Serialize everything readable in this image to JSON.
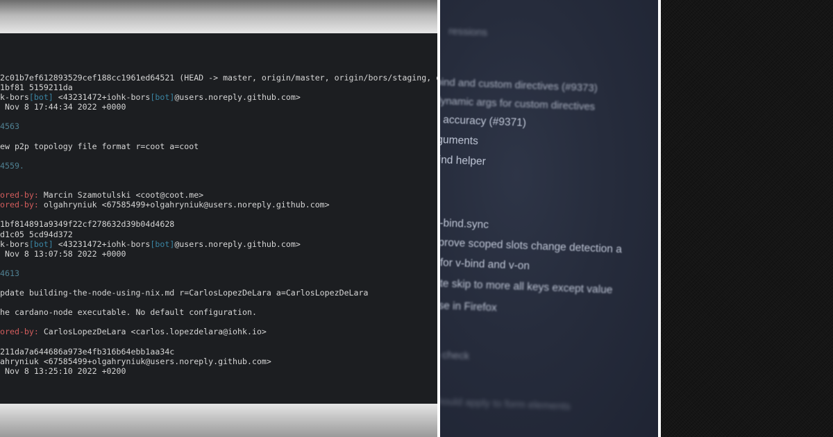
{
  "terminal": {
    "lines": [
      {
        "parts": [
          {
            "t": "2c01b7ef612893529cef188cc1961ed64521 (HEAD -> master, origin/master, origin/bors/staging, or",
            "c": ""
          }
        ]
      },
      {
        "parts": [
          {
            "t": "1bf81 5159211da",
            "c": ""
          }
        ]
      },
      {
        "parts": [
          {
            "t": "k-bors",
            "c": ""
          },
          {
            "t": "[bot]",
            "c": "c-blue"
          },
          {
            "t": " <43231472+iohk-bors",
            "c": ""
          },
          {
            "t": "[bot]",
            "c": "c-blue"
          },
          {
            "t": "@users.noreply.github.com>",
            "c": ""
          }
        ]
      },
      {
        "parts": [
          {
            "t": " Nov 8 17:44:34 2022 +0000",
            "c": ""
          }
        ]
      },
      {
        "parts": []
      },
      {
        "parts": [
          {
            "t": "4563",
            "c": "c-dim"
          }
        ]
      },
      {
        "parts": []
      },
      {
        "parts": [
          {
            "t": "ew p2p topology file format r=coot a=coot",
            "c": ""
          }
        ]
      },
      {
        "parts": []
      },
      {
        "parts": [
          {
            "t": "4559.",
            "c": "c-dim"
          }
        ]
      },
      {
        "parts": []
      },
      {
        "parts": []
      },
      {
        "parts": [
          {
            "t": "ored-by:",
            "c": "c-red"
          },
          {
            "t": " Marcin Szamotulski <coot@coot.me>",
            "c": ""
          }
        ]
      },
      {
        "parts": [
          {
            "t": "ored-by:",
            "c": "c-red"
          },
          {
            "t": " olgahryniuk <67585499+olgahryniuk@users.noreply.github.com>",
            "c": ""
          }
        ]
      },
      {
        "parts": []
      },
      {
        "parts": [
          {
            "t": "1bf814891a9349f22cf278632d39b04d4628",
            "c": ""
          }
        ]
      },
      {
        "parts": [
          {
            "t": "d1c05 5cd94d372",
            "c": ""
          }
        ]
      },
      {
        "parts": [
          {
            "t": "k-bors",
            "c": ""
          },
          {
            "t": "[bot]",
            "c": "c-blue"
          },
          {
            "t": " <43231472+iohk-bors",
            "c": ""
          },
          {
            "t": "[bot]",
            "c": "c-blue"
          },
          {
            "t": "@users.noreply.github.com>",
            "c": ""
          }
        ]
      },
      {
        "parts": [
          {
            "t": " Nov 8 13:07:58 2022 +0000",
            "c": ""
          }
        ]
      },
      {
        "parts": []
      },
      {
        "parts": [
          {
            "t": "4613",
            "c": "c-dim"
          }
        ]
      },
      {
        "parts": []
      },
      {
        "parts": [
          {
            "t": "pdate building-the-node-using-nix.md r=CarlosLopezDeLara a=CarlosLopezDeLara",
            "c": ""
          }
        ]
      },
      {
        "parts": []
      },
      {
        "parts": [
          {
            "t": "he cardano-node executable. No default configuration.",
            "c": ""
          }
        ]
      },
      {
        "parts": []
      },
      {
        "parts": [
          {
            "t": "ored-by:",
            "c": "c-red"
          },
          {
            "t": " CarlosLopezDeLara <carlos.lopezdelara@iohk.io>",
            "c": ""
          }
        ]
      },
      {
        "parts": []
      },
      {
        "parts": [
          {
            "t": "211da7a644686a973e4fb316b64ebb1aa34c",
            "c": ""
          }
        ]
      },
      {
        "parts": [
          {
            "t": "ahryniuk <67585499+olgahryniuk@users.noreply.github.com>",
            "c": ""
          }
        ]
      },
      {
        "parts": [
          {
            "t": " Nov 8 13:25:10 2022 +0200",
            "c": ""
          }
        ]
      }
    ]
  },
  "photo": {
    "line_1": "ressions",
    "line_2": "bind and custom directives (#9373)",
    "line_3": "dynamic args for custom directives",
    "line_4": "n accuracy (#9371)",
    "line_5": "rguments",
    "line_6": "bind helper",
    "line_7": "v-bind.sync",
    "line_8": "mprove scoped slots change detection a",
    "line_9": "ts for v-bind and v-on",
    "line_10": "date skip to more all keys except value",
    "line_11": "case in Firefox",
    "line_12": "p check",
    "line_13": "should apply to form elements"
  }
}
